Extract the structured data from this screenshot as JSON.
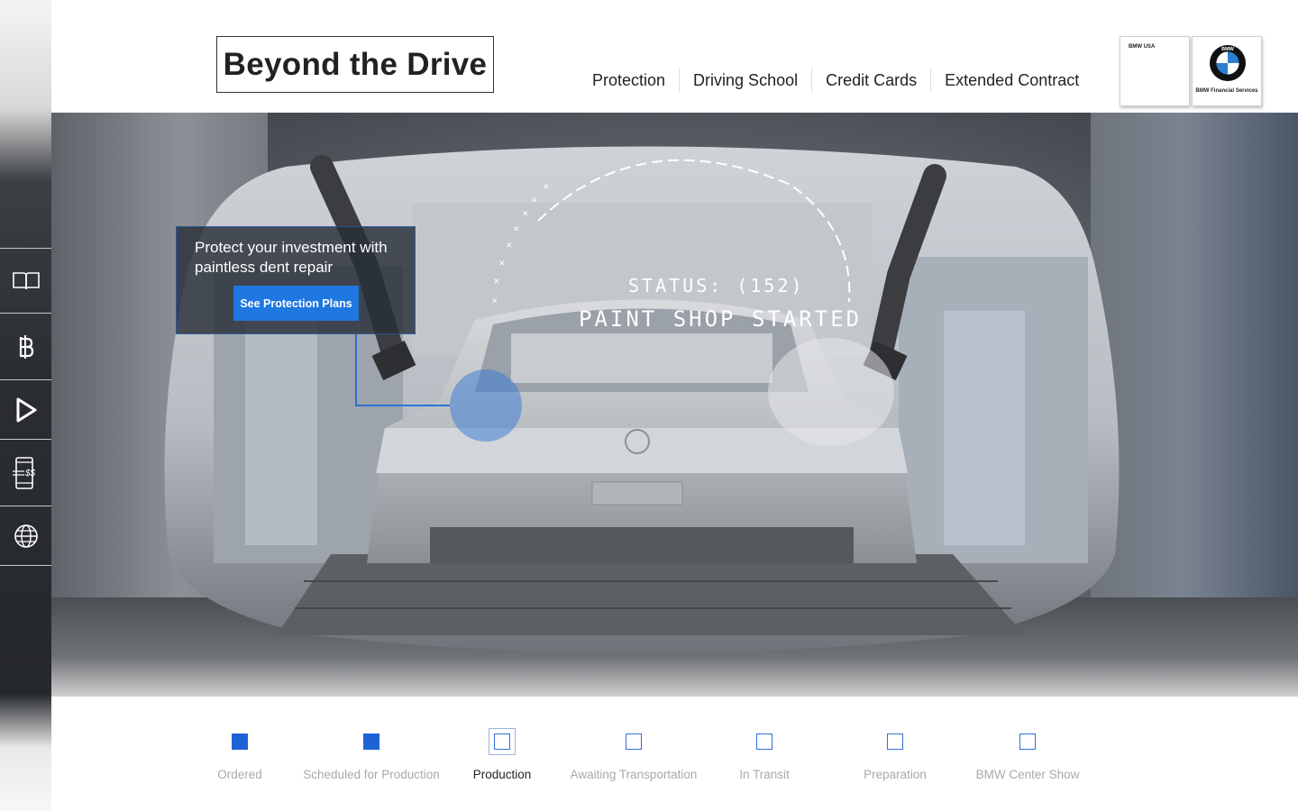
{
  "header": {
    "title": "Beyond the Drive",
    "nav": [
      {
        "label": "Protection"
      },
      {
        "label": "Driving School"
      },
      {
        "label": "Credit Cards"
      },
      {
        "label": "Extended Contract"
      }
    ],
    "logos": {
      "usa": "BMW USA",
      "financial": "BMW Financial Services",
      "roundel_letters": "BMW"
    }
  },
  "sidebar": {
    "items": [
      {
        "icon": "book-icon"
      },
      {
        "icon": "baht-currency-icon"
      },
      {
        "icon": "play-icon"
      },
      {
        "icon": "mobile-payment-icon",
        "glyph": "$$"
      },
      {
        "icon": "globe-icon"
      }
    ]
  },
  "hero": {
    "status_line": "STATUS: (152)",
    "status_title": "PAINT SHOP STARTED",
    "promo_text": "Protect your investment with paintless dent repair",
    "promo_button": "See Protection Plans"
  },
  "progress": {
    "steps": [
      {
        "label": "Ordered",
        "state": "done"
      },
      {
        "label": "Scheduled for Production",
        "state": "done"
      },
      {
        "label": "Production",
        "state": "current"
      },
      {
        "label": "Awaiting Transportation",
        "state": "pending"
      },
      {
        "label": "In Transit",
        "state": "pending"
      },
      {
        "label": "Preparation",
        "state": "pending"
      },
      {
        "label": "BMW Center Show",
        "state": "pending"
      }
    ]
  },
  "colors": {
    "accent": "#1f77e0",
    "step_done": "#1e63d6",
    "sidebar_dark": "#2a2d31"
  }
}
